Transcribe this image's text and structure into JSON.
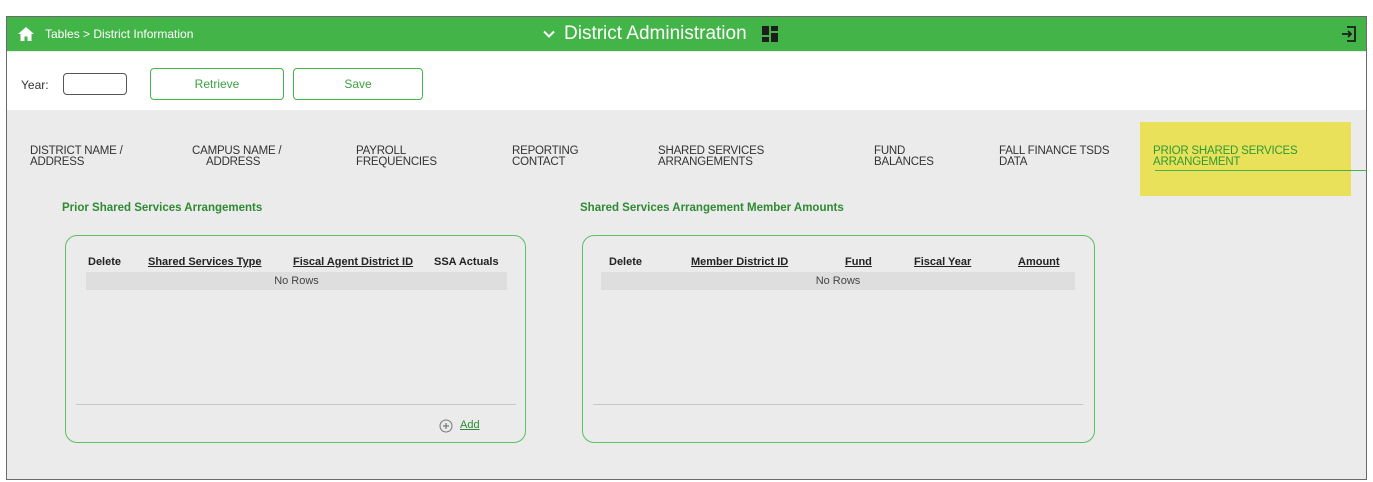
{
  "header": {
    "breadcrumb": "Tables > District Information",
    "app_title": "District Administration",
    "home_icon": "home-icon",
    "dropdown_icon": "chevron-down-icon",
    "menu_icon": "grid-icon",
    "exit_icon": "exit-icon",
    "bar_color": "#43b548"
  },
  "toolbar": {
    "year_label": "Year:",
    "year_value": "",
    "retrieve_label": "Retrieve",
    "save_label": "Save"
  },
  "tabs": [
    {
      "line1": "DISTRICT NAME /",
      "line2": "ADDRESS"
    },
    {
      "line1": "CAMPUS NAME /",
      "line2": "ADDRESS"
    },
    {
      "line1": "PAYROLL",
      "line2": "FREQUENCIES"
    },
    {
      "line1": "REPORTING",
      "line2": "CONTACT"
    },
    {
      "line1": "SHARED SERVICES",
      "line2": "ARRANGEMENTS"
    },
    {
      "line1": "FUND",
      "line2": "BALANCES"
    },
    {
      "line1": "FALL FINANCE TSDS",
      "line2": "DATA"
    },
    {
      "line1": "PRIOR SHARED SERVICES",
      "line2": "ARRANGEMENT"
    }
  ],
  "active_tab_color": "#e9e15a",
  "left_panel": {
    "title": "Prior Shared Services Arrangements",
    "columns": [
      "Delete",
      "Shared Services Type",
      "Fiscal Agent District ID",
      "SSA Actuals"
    ],
    "empty_text": "No Rows",
    "add_label": "Add",
    "add_icon": "plus-circle-icon"
  },
  "right_panel": {
    "title": "Shared Services Arrangement Member Amounts",
    "columns": [
      "Delete",
      "Member District ID",
      "Fund",
      "Fiscal Year",
      "Amount"
    ],
    "empty_text": "No Rows"
  }
}
